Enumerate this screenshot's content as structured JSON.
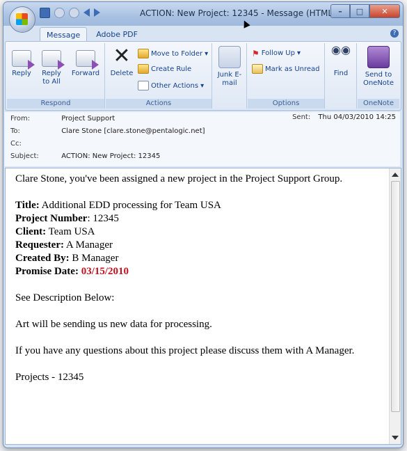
{
  "window": {
    "title": "ACTION: New Project: 12345 - Message (HTML)"
  },
  "tabs": [
    {
      "label": "Message"
    },
    {
      "label": "Adobe PDF"
    }
  ],
  "ribbon": {
    "respond": {
      "group_label": "Respond",
      "reply": "Reply",
      "reply_all": "Reply to All",
      "forward": "Forward"
    },
    "actions": {
      "group_label": "Actions",
      "delete": "Delete",
      "move_to_folder": "Move to Folder",
      "create_rule": "Create Rule",
      "other_actions": "Other Actions"
    },
    "junk": {
      "label": "Junk E-mail"
    },
    "options": {
      "group_label": "Options",
      "follow_up": "Follow Up",
      "mark_as_unread": "Mark as Unread"
    },
    "find": {
      "label": "Find"
    },
    "onenote": {
      "group_label": "OneNote",
      "send_to_onenote": "Send to OneNote"
    }
  },
  "header": {
    "from_label": "From:",
    "from_value": "Project Support",
    "to_label": "To:",
    "to_value": "Clare Stone [clare.stone@pentalogic.net]",
    "cc_label": "Cc:",
    "subject_label": "Subject:",
    "subject_value": "ACTION: New Project: 12345",
    "sent_label": "Sent:",
    "sent_value": "Thu 04/03/2010 14:25"
  },
  "message": {
    "intro": "Clare Stone, you've been assigned a new project in the Project Support Group.",
    "title_label": "Title:",
    "title_value": "Additional EDD processing for Team USA",
    "project_number_label": "Project Number",
    "project_number_value": ": 12345",
    "client_label": "Client:",
    "client_value": "Team USA",
    "requester_label": "Requester:",
    "requester_value": "A Manager",
    "created_by_label": "Created By:",
    "created_by_value": "B Manager",
    "promise_date_label": "Promise Date:",
    "promise_date_value": "03/15/2010",
    "see_description": "See Description Below:",
    "description": "Art will be sending us new data for processing.",
    "questions": "If you have any questions about this project please discuss them with A Manager.",
    "footer": "Projects - 12345"
  },
  "colors": {
    "accent": "#15428b",
    "promise_date": "#c1121f",
    "close_button": "#c8442b"
  }
}
